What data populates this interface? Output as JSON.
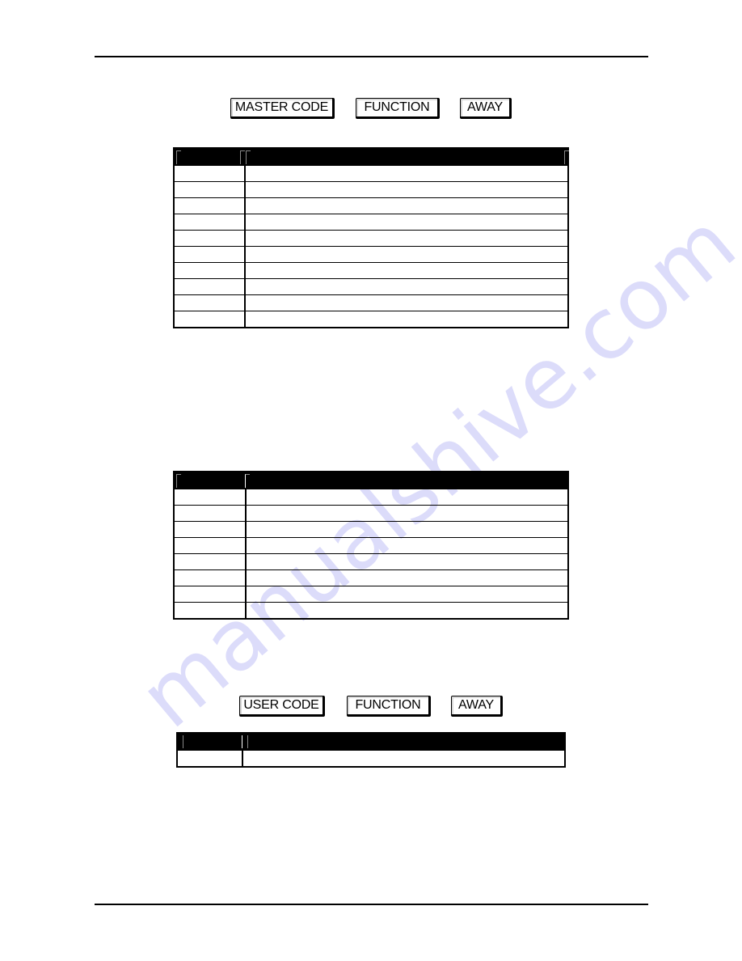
{
  "watermark": {
    "text": "manualshive.com",
    "color": "#dcdcfa"
  },
  "key_sequence_1": {
    "keys": [
      "MASTER CODE",
      "FUNCTION",
      "AWAY"
    ]
  },
  "table_1": {
    "header": [
      "",
      ""
    ],
    "rows": [
      [
        "",
        ""
      ],
      [
        "",
        ""
      ],
      [
        "",
        ""
      ],
      [
        "",
        ""
      ],
      [
        "",
        ""
      ],
      [
        "",
        ""
      ],
      [
        "",
        ""
      ],
      [
        "",
        ""
      ],
      [
        "",
        ""
      ],
      [
        "",
        ""
      ]
    ]
  },
  "table_2": {
    "header": [
      "",
      ""
    ],
    "rows": [
      [
        "",
        ""
      ],
      [
        "",
        ""
      ],
      [
        "",
        ""
      ],
      [
        "",
        ""
      ],
      [
        "",
        ""
      ],
      [
        "",
        ""
      ],
      [
        "",
        ""
      ],
      [
        "",
        ""
      ]
    ]
  },
  "key_sequence_2": {
    "keys": [
      "USER CODE",
      "FUNCTION",
      "AWAY"
    ]
  },
  "table_3": {
    "header": [
      "",
      ""
    ],
    "rows": [
      [
        "",
        ""
      ]
    ]
  }
}
